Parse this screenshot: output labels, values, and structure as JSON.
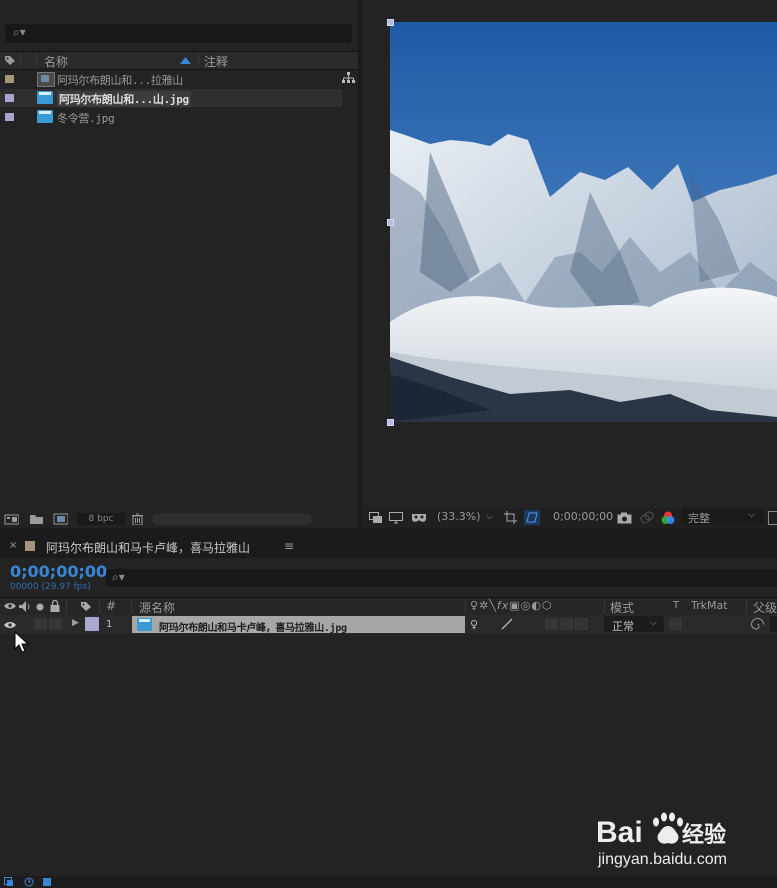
{
  "project": {
    "search_icon": "⌕▾",
    "columns": {
      "name": "名称",
      "comment": "注释"
    },
    "items": [
      {
        "name": "阿玛尔布朗山和...拉雅山",
        "label_color": "#a5957a",
        "type": "composition"
      },
      {
        "name": "阿玛尔布朗山和...山.jpg",
        "label_color": "#a9a6cf",
        "type": "image",
        "selected": true
      },
      {
        "name": "冬令营.jpg",
        "label_color": "#a9a6cf",
        "type": "image"
      }
    ],
    "footer": {
      "bpc": "8 bpc"
    }
  },
  "viewer": {
    "zoom": "(33.3%)",
    "timecode": "0;00;00;00",
    "quality": "完整"
  },
  "timeline": {
    "comp_tab": "阿玛尔布朗山和马卡卢峰，喜马拉雅山",
    "timecode": "0;00;00;00",
    "frames": "00000 (29.97 fps)",
    "columns": {
      "hash": "#",
      "source_name": "源名称",
      "mode": "模式",
      "t": "T",
      "trkmat": "TrkMat",
      "parent": "父级"
    },
    "layers": [
      {
        "index": "1",
        "name": "阿玛尔布朗山和马卡卢峰，喜马拉雅山.jpg",
        "mode": "正常",
        "label_color": "#a9a6cf"
      }
    ]
  },
  "watermark": {
    "brand": "Bai du 经验",
    "url": "jingyan.baidu.com"
  },
  "colors": {
    "accent_blue": "#3a86d6",
    "panel": "#232323",
    "background": "#1b1b1b"
  }
}
